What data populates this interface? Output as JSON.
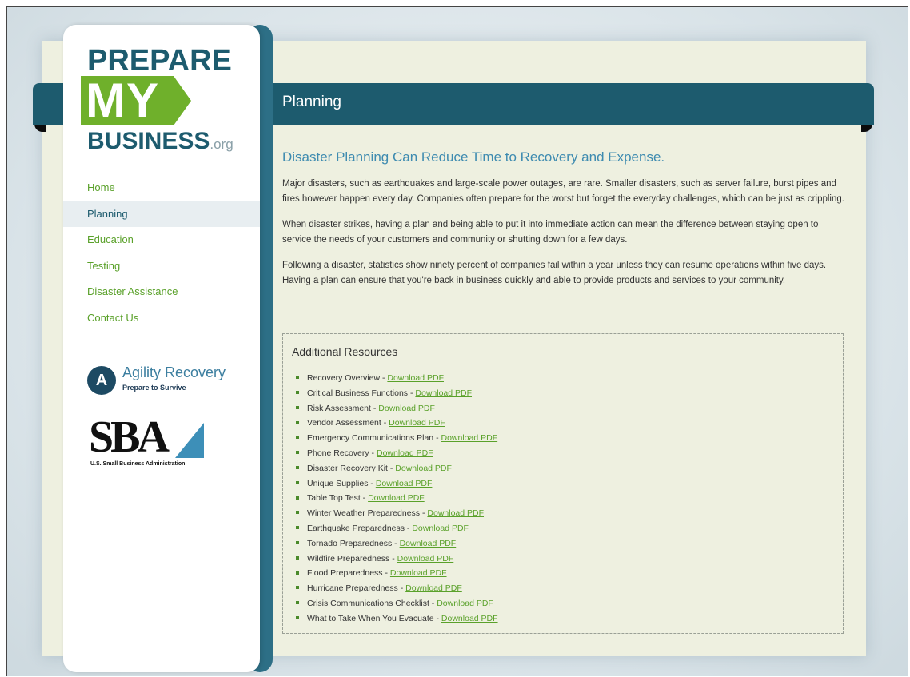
{
  "logo": {
    "line1": "PREPARE",
    "line2": "MY",
    "line3": "BUSINESS",
    "suffix": ".org",
    "colors": {
      "teal": "#1d5b6e",
      "green": "#6fb02b"
    }
  },
  "nav": {
    "items": [
      {
        "label": "Home",
        "active": false
      },
      {
        "label": "Planning",
        "active": true
      },
      {
        "label": "Education",
        "active": false
      },
      {
        "label": "Testing",
        "active": false
      },
      {
        "label": "Disaster Assistance",
        "active": false
      },
      {
        "label": "Contact Us",
        "active": false
      }
    ]
  },
  "partners": {
    "agility": {
      "icon_letter": "A",
      "name": "Agility Recovery",
      "tagline": "Prepare to Survive"
    },
    "sba": {
      "letters": "SBA",
      "subtitle": "U.S. Small Business Administration"
    }
  },
  "header": {
    "title": "Planning"
  },
  "main": {
    "heading": "Disaster Planning Can Reduce Time to Recovery and Expense.",
    "paragraphs": [
      "Major disasters, such as earthquakes and large-scale power outages, are rare. Smaller disasters, such as server failure, burst pipes and fires however happen every day. Companies often prepare for the worst but forget the everyday challenges, which can be just as crippling.",
      "When disaster strikes, having a plan and being able to put it into immediate action can mean the difference between staying open to service the needs of your customers and community or shutting down for a few days.",
      "Following a disaster, statistics show ninety percent of companies fail within a year unless they can resume operations within five days. Having a plan can ensure that you're back in business quickly and able to provide products and services to your community."
    ]
  },
  "resources": {
    "title": "Additional Resources",
    "separator": " - ",
    "link_label": "Download PDF",
    "items": [
      "Recovery Overview",
      "Critical Business Functions",
      "Risk Assessment",
      "Vendor Assessment",
      "Emergency Communications Plan",
      "Phone Recovery",
      "Disaster Recovery Kit",
      "Unique Supplies",
      "Table Top Test",
      "Winter Weather Preparedness",
      "Earthquake Preparedness",
      "Tornado Preparedness",
      "Wildfire Preparedness",
      "Flood Preparedness",
      "Hurricane Preparedness",
      "Crisis Communications Checklist",
      "What to Take When You Evacuate"
    ]
  },
  "colors": {
    "header_band": "#1d5b6e",
    "link_green": "#5aa12a",
    "heading_blue": "#3e8bb0",
    "content_bg": "#eef0e0"
  }
}
